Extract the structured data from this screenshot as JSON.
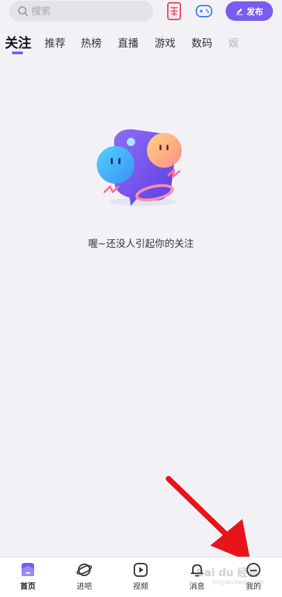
{
  "search": {
    "placeholder": "搜索"
  },
  "header": {
    "publish_label": "发布"
  },
  "tabs": [
    {
      "label": "关注",
      "active": true
    },
    {
      "label": "推荐"
    },
    {
      "label": "热榜"
    },
    {
      "label": "直播"
    },
    {
      "label": "游戏"
    },
    {
      "label": "数码"
    },
    {
      "label": "娱"
    }
  ],
  "empty_state": {
    "message": "喔~还没人引起你的关注"
  },
  "bottom_nav": [
    {
      "label": "首页",
      "icon": "home-icon",
      "active": true
    },
    {
      "label": "进吧",
      "icon": "planet-icon"
    },
    {
      "label": "视频",
      "icon": "play-icon"
    },
    {
      "label": "消息",
      "icon": "bell-icon"
    },
    {
      "label": "我的",
      "icon": "profile-icon"
    }
  ],
  "watermark": {
    "text": "Bai du 经验",
    "sub": "jingyan.baidu.com"
  },
  "colors": {
    "accent": "#7a5cf0",
    "background": "#f2f2f6",
    "arrow": "#e8141b"
  }
}
